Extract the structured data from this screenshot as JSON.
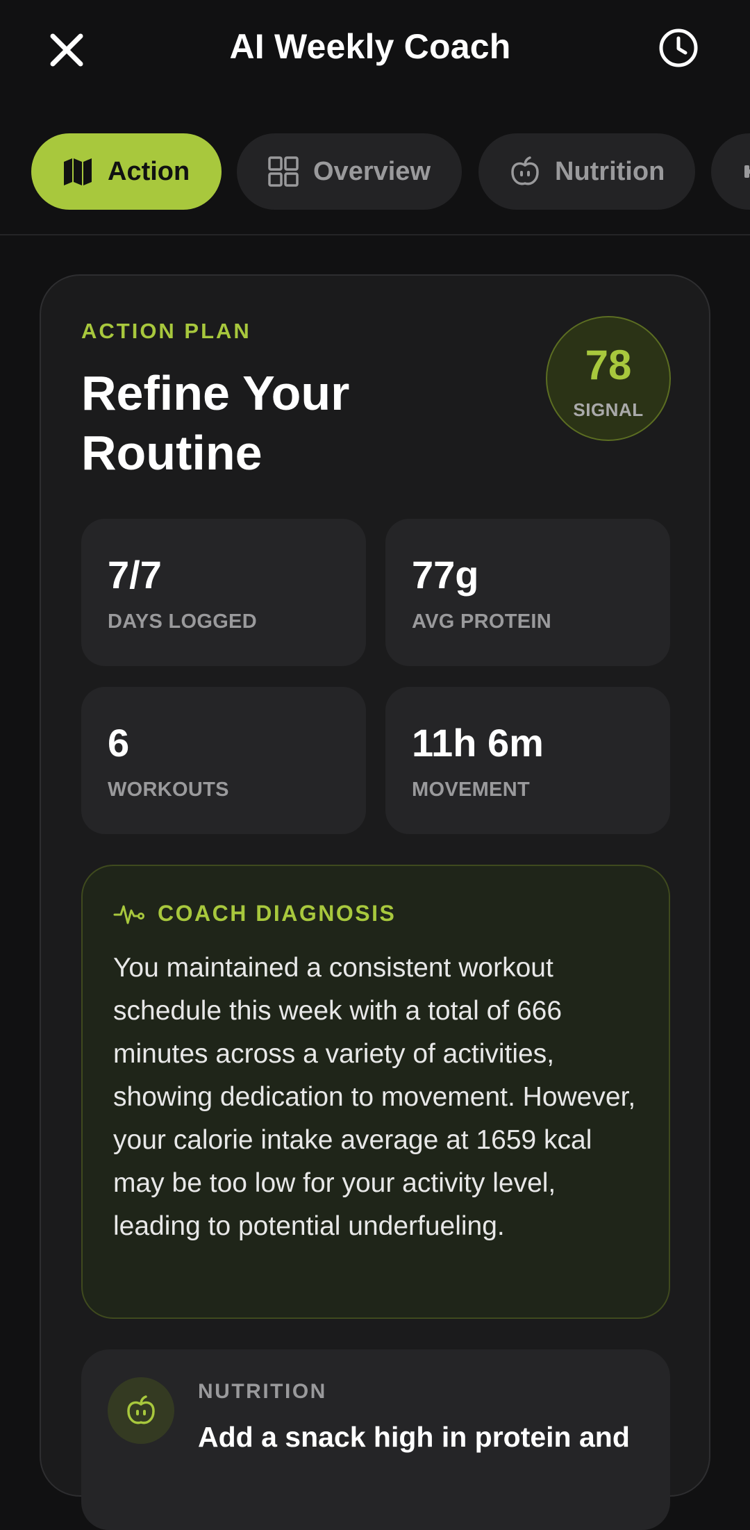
{
  "header": {
    "title": "AI Weekly Coach",
    "close_icon": "close-icon",
    "history_icon": "clock-icon"
  },
  "tabs": [
    {
      "label": "Action",
      "icon": "map-icon",
      "active": true
    },
    {
      "label": "Overview",
      "icon": "grid-icon",
      "active": false
    },
    {
      "label": "Nutrition",
      "icon": "apple-icon",
      "active": false
    },
    {
      "label": "",
      "icon": "dumbbell-icon",
      "active": false
    }
  ],
  "plan": {
    "eyebrow": "ACTION PLAN",
    "headline": "Refine Your Routine",
    "signal_value": "78",
    "signal_label": "SIGNAL"
  },
  "stats": [
    {
      "value": "7/7",
      "label": "DAYS LOGGED"
    },
    {
      "value": "77g",
      "label": "AVG PROTEIN"
    },
    {
      "value": "6",
      "label": "WORKOUTS"
    },
    {
      "value": "11h 6m",
      "label": "MOVEMENT"
    }
  ],
  "diagnosis": {
    "title": "COACH DIAGNOSIS",
    "text": "You maintained a consistent workout schedule this week with a total of 666 minutes across a variety of activities, showing dedication to movement. However, your calorie intake average at 1659 kcal may be too low for your activity level, leading to potential underfueling."
  },
  "recommendation": {
    "category": "NUTRITION",
    "text": "Add a snack high in protein and"
  },
  "colors": {
    "accent": "#a8c83d",
    "background": "#111112",
    "card": "#1b1b1c"
  }
}
